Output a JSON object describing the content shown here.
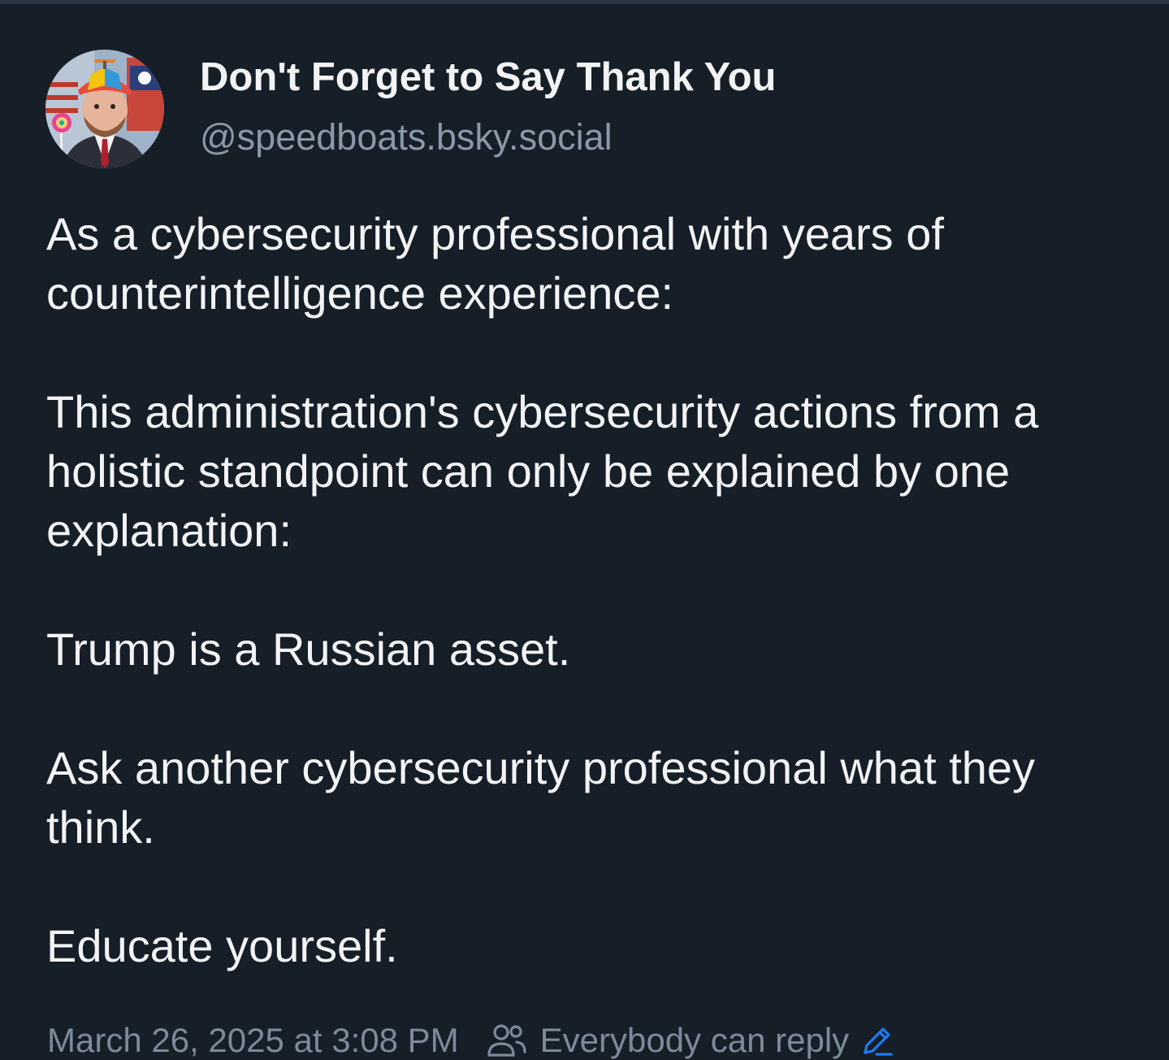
{
  "author": {
    "display_name": "Don't Forget to Say Thank You",
    "handle": "@speedboats.bsky.social",
    "avatar_icon": "profile-photo"
  },
  "post": {
    "paragraphs": [
      "As a cybersecurity professional with years of counterintelligence experience:",
      "This administration's cybersecurity actions from a holistic standpoint can only be explained by one explanation:",
      "Trump is a Russian asset.",
      "Ask another cybersecurity professional what they think.",
      "Educate yourself."
    ]
  },
  "meta": {
    "timestamp": "March 26, 2025 at 3:08 PM",
    "reply_setting": "Everybody can reply",
    "reply_icon": "people-icon",
    "edit_icon": "pencil-icon"
  },
  "colors": {
    "background": "#161e27",
    "text": "#f1f3f5",
    "muted": "#7d8a9b",
    "accent": "#1d7cf2"
  }
}
